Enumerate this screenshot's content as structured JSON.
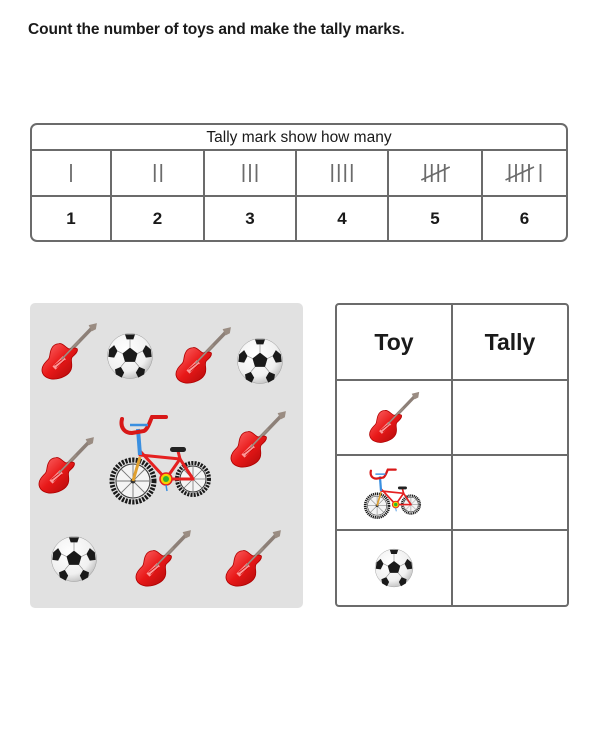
{
  "instruction": "Count the number of toys and make the tally marks.",
  "reference_table": {
    "title": "Tally mark show how many",
    "columns": [
      {
        "tally_count": 1,
        "number": "1"
      },
      {
        "tally_count": 2,
        "number": "2"
      },
      {
        "tally_count": 3,
        "number": "3"
      },
      {
        "tally_count": 4,
        "number": "4"
      },
      {
        "tally_count": 5,
        "number": "5"
      },
      {
        "tally_count": 6,
        "number": "6"
      }
    ]
  },
  "picture": {
    "background": "#e1e1e1",
    "toys": [
      {
        "type": "guitar-icon"
      },
      {
        "type": "soccer-ball-icon"
      },
      {
        "type": "guitar-icon"
      },
      {
        "type": "soccer-ball-icon"
      },
      {
        "type": "guitar-icon"
      },
      {
        "type": "bicycle-icon"
      },
      {
        "type": "guitar-icon"
      },
      {
        "type": "soccer-ball-icon"
      },
      {
        "type": "guitar-icon"
      },
      {
        "type": "guitar-icon"
      }
    ]
  },
  "answer_table": {
    "headers": {
      "toy": "Toy",
      "tally": "Tally"
    },
    "rows": [
      {
        "toy": "guitar-icon",
        "tally": ""
      },
      {
        "toy": "bicycle-icon",
        "tally": ""
      },
      {
        "toy": "soccer-ball-icon",
        "tally": ""
      }
    ]
  },
  "colors": {
    "guitar_red": "#e01818",
    "border_gray": "#6b6b6b",
    "bike_red": "#e52020",
    "bike_blue": "#3a8fe0"
  }
}
